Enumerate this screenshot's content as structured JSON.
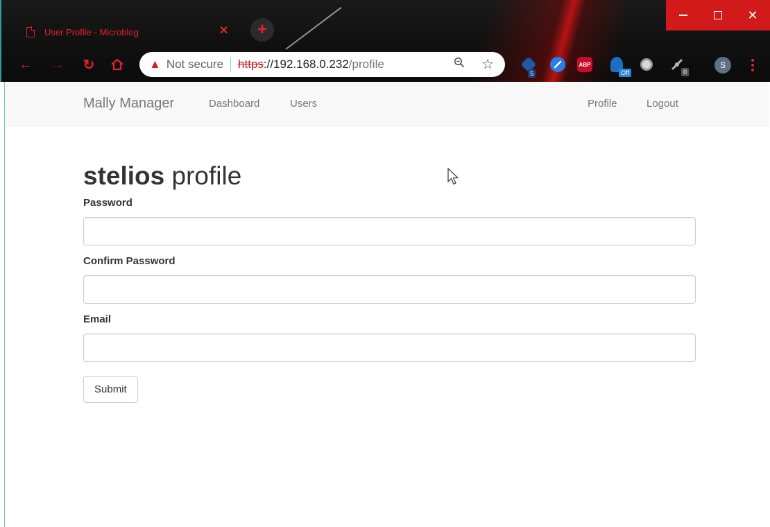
{
  "browser": {
    "tab_title": "User Profile - Microblog",
    "new_tab_label": "+",
    "address": {
      "security_label": "Not secure",
      "scheme": "https",
      "host": "://192.168.0.232",
      "path": "/profile"
    },
    "extensions": [
      {
        "name": "extension-1",
        "badge": "5",
        "color": "#1e5aa8"
      },
      {
        "name": "extension-2",
        "badge": "",
        "color": "#2b7de9"
      },
      {
        "name": "adblock-plus",
        "text": "ABP",
        "badge": "",
        "color": "#c70d2c"
      },
      {
        "name": "extension-4",
        "badge": "Off",
        "color": "#1e6fc4"
      },
      {
        "name": "extension-5",
        "badge": "",
        "color": "#9a9a9a"
      },
      {
        "name": "extension-6",
        "badge": "0",
        "color": "#7a7a7a"
      }
    ],
    "profile_initial": "S",
    "accent": "#e3222d"
  },
  "navbar": {
    "brand": "Mally Manager",
    "links": {
      "dashboard": "Dashboard",
      "users": "Users",
      "profile": "Profile",
      "logout": "Logout"
    }
  },
  "page": {
    "username": "stelios",
    "heading_suffix": "profile",
    "form": {
      "password_label": "Password",
      "password_value": "",
      "confirm_password_label": "Confirm Password",
      "confirm_password_value": "",
      "email_label": "Email",
      "email_value": "",
      "submit_label": "Submit"
    }
  }
}
